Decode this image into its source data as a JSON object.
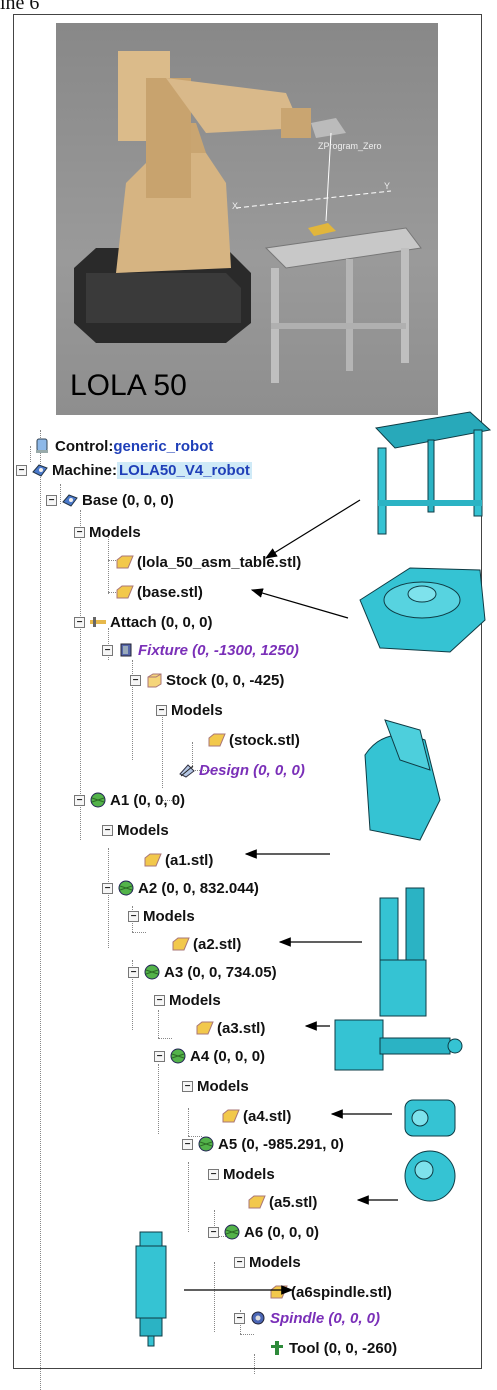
{
  "page": {
    "corner_text": "ine 6"
  },
  "render": {
    "label": "LOLA 50",
    "zero_label": "ZProgram_Zero",
    "axis_x": "X",
    "axis_y": "Y"
  },
  "tree": {
    "control": {
      "key": "Control",
      "sep": " : ",
      "value": "generic_robot"
    },
    "machine": {
      "key": "Machine",
      "sep": " : ",
      "value": "LOLA50_V4_robot"
    },
    "base": "Base (0, 0, 0)",
    "base_models": "Models",
    "table_model": "(lola_50_asm_table.stl)",
    "base_model": "(base.stl)",
    "attach": "Attach (0, 0, 0)",
    "fixture": "Fixture (0, -1300, 1250)",
    "stock": "Stock (0, 0, -425)",
    "stock_models": "Models",
    "stock_model": "(stock.stl)",
    "design": "Design (0, 0, 0)",
    "a1": "A1 (0, 0, 0)",
    "a1_models": "Models",
    "a1_model": "(a1.stl)",
    "a2": "A2 (0, 0, 832.044)",
    "a2_models": "Models",
    "a2_model": "(a2.stl)",
    "a3": "A3 (0, 0, 734.05)",
    "a3_models": "Models",
    "a3_model": "(a3.stl)",
    "a4": "A4 (0, 0, 0)",
    "a4_models": "Models",
    "a4_model": "(a4.stl)",
    "a5": "A5 (0, -985.291, 0)",
    "a5_models": "Models",
    "a5_model": "(a5.stl)",
    "a6": "A6 (0, 0, 0)",
    "a6_models": "Models",
    "a6_model": "(a6spindle.stl)",
    "spindle": "Spindle (0, 0, 0)",
    "tool": "Tool (0, 0, -260)"
  },
  "colors": {
    "cad_cyan": "#35c3d3",
    "robot_tan": "#d9b98a",
    "link_blue": "#1f3fb8",
    "italic_purple": "#7a2fb8",
    "selection": "#cfeaf7"
  },
  "icons": [
    "computer-icon",
    "machine-icon",
    "model-folder-icon",
    "attach-icon",
    "fixture-icon",
    "stock-box-icon",
    "design-icon",
    "axis-sphere-icon",
    "spindle-icon",
    "tool-icon"
  ]
}
